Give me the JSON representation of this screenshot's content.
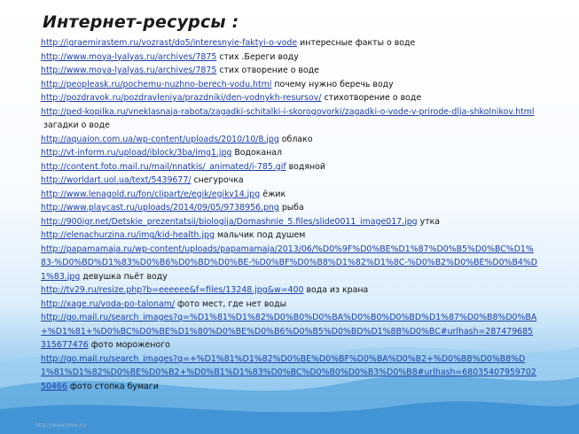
{
  "title": "Интернет-ресурсы :",
  "footer": "http://www.rmix.ru",
  "items": [
    {
      "url": "http://igraemirastem.ru/vozrast/do5/interesnyie-faktyi-o-vode",
      "desc": "интересные факты о воде"
    },
    {
      "url": "http://www.moya-lyalyas.ru/archives/7875",
      "desc": "стих .Береги воду"
    },
    {
      "url": "http://www.moya-lyalyas.ru/archives/7875",
      "desc": "стих отворение о воде"
    },
    {
      "url": "http://peopleask.ru/pochemu-nuzhno-berech-vodu.html",
      "desc": "почему нужно беречь воду"
    },
    {
      "url": "http://pozdravok.ru/pozdravleniya/prazdniki/den-vodnykh-resursov/",
      "desc": "стихотворение о воде"
    },
    {
      "url": "http://ped-kopilka.ru/vneklasnaja-rabota/zagadki-schitalki-i-skorogovorki/zagadki-o-vode-v-prirode-dlja-shkolnikov.html",
      "desc": "загадки о воде"
    },
    {
      "url": "http://aquaion.com.ua/wp-content/uploads/2010/10/8.jpg",
      "desc": "облако"
    },
    {
      "url": "http://vt-inform.ru/upload/iblock/3ba/img1.jpg",
      "desc": "Водоканал"
    },
    {
      "url": "http://content.foto.mail.ru/mail/nnatkis/_animated/i-785.gif",
      "desc": "водяной"
    },
    {
      "url": "http://worldart.uol.ua/text/5439677/",
      "desc": "снегурочка"
    },
    {
      "url": "http://www.lenagold.ru/fon/clipart/e/egik/egiky14.jpg",
      "desc": "ёжик"
    },
    {
      "url": "http://www.playcast.ru/uploads/2014/09/05/9738956.png",
      "desc": "рыба"
    },
    {
      "url": "http://900igr.net/Detskie_prezentatsii/biologija/Domashnie_5.files/slide0011_image017.jpg",
      "desc": "утка"
    },
    {
      "url": "http://elenachurzina.ru/img/kid-health.jpg",
      "desc": "мальчик под душем"
    },
    {
      "url": "http://papamamaja.ru/wp-content/uploads/papamamaja/2013/06/%D0%9F%D0%BE%D1%87%D0%B5%D0%BC%D1%83-%D0%BD%D1%83%D0%B6%D0%BD%D0%BE-%D0%BF%D0%B8%D1%82%D1%8C-%D0%B2%D0%BE%D0%B4%D1%83.jpg",
      "desc": "девушка пьёт воду"
    },
    {
      "url": "http://tv29.ru/resize.php?b=eeeeee&f=files/13248.jpg&w=400",
      "desc": "вода из крана"
    },
    {
      "url": "http://xage.ru/voda-po-talonam/",
      "desc": "фото мест, где нет воды"
    },
    {
      "url": "http://go.mail.ru/search_images?q=%D1%81%D1%82%D0%B0%D0%BA%D0%B0%D0%BD%D1%87%D0%B8%D0%BA+%D1%81+%D0%BC%D0%BE%D1%80%D0%BE%D0%B6%D0%B5%D0%BD%D1%8B%D0%BC#urlhash=287479685315677476",
      "desc": "фото мороженого"
    },
    {
      "url": "http://go.mail.ru/search_images?q=+%D1%81%D1%82%D0%BE%D0%BF%D0%BA%D0%B2+%D0%BB%D0%B8%D1%81%D1%82%D0%BE%D0%B2+%D0%B1%D1%83%D0%BC%D0%B0%D0%B3%D0%B8#urlhash=6803540795970250466",
      "desc": "фото стопка бумаги"
    }
  ]
}
